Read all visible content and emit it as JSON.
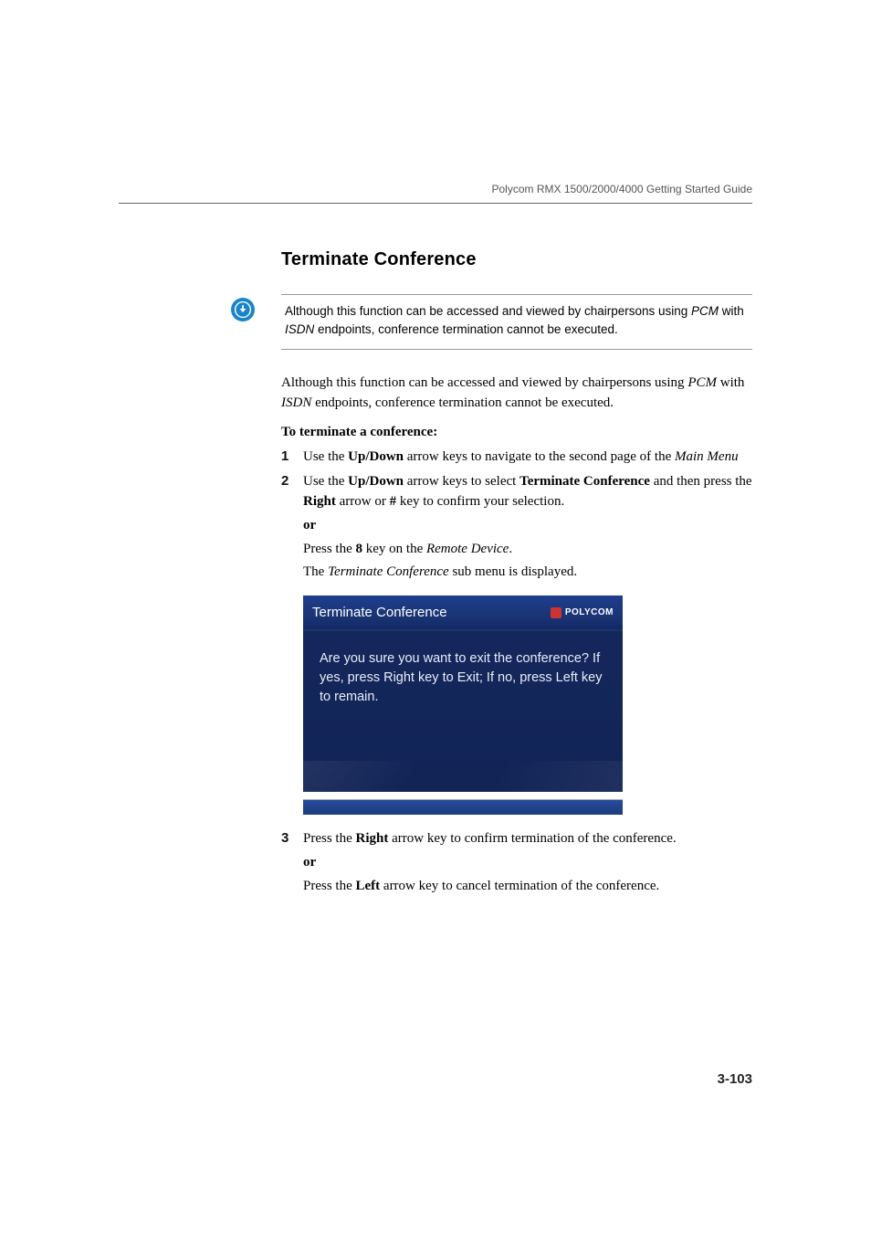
{
  "header": {
    "guide_title": "Polycom RMX 1500/2000/4000 Getting Started Guide"
  },
  "section": {
    "title": "Terminate Conference"
  },
  "note": {
    "text_1": "Although this function can be accessed and viewed by chairpersons using ",
    "em_1": "PCM",
    "text_2": " with ",
    "em_2": "ISDN",
    "text_3": " endpoints, conference termination cannot be executed."
  },
  "intro": {
    "text_1": "Although this function can be accessed and viewed by chairpersons using ",
    "em_1": "PCM",
    "text_2": " with ",
    "em_2": "ISDN",
    "text_3": " endpoints, conference termination cannot be executed."
  },
  "subheading": "To terminate a conference:",
  "steps": {
    "s1": {
      "num": "1",
      "t1": "Use the ",
      "b1": "Up/Down",
      "t2": " arrow keys to navigate to the second page of the ",
      "i1": "Main Menu"
    },
    "s2": {
      "num": "2",
      "t1": "Use the ",
      "b1": "Up/Down",
      "t2": " arrow keys to select ",
      "b2": "Terminate Conference",
      "t3": " and then press the ",
      "b3": "Right",
      "t4": " arrow or ",
      "b4": "#",
      "t5": " key to confirm your selection.",
      "or": "or",
      "c1": "Press the ",
      "cb1": "8",
      "c2": " key on the ",
      "ci1": "Remote Device",
      "c3": ".",
      "d1": "The ",
      "di1": "Terminate Conference",
      "d2": " sub menu is displayed."
    },
    "s3": {
      "num": "3",
      "t1": "Press the ",
      "b1": "Right",
      "t2": " arrow key to confirm termination of the conference.",
      "or": "or",
      "c1": "Press the ",
      "cb1": "Left",
      "c2": " arrow key to cancel termination of the conference."
    }
  },
  "screenshot": {
    "title": "Terminate Conference",
    "brand": "POLYCOM",
    "body": "Are you sure you want to exit the conference? If yes, press Right key to Exit; If no, press Left key to remain."
  },
  "page_number": "3-103"
}
